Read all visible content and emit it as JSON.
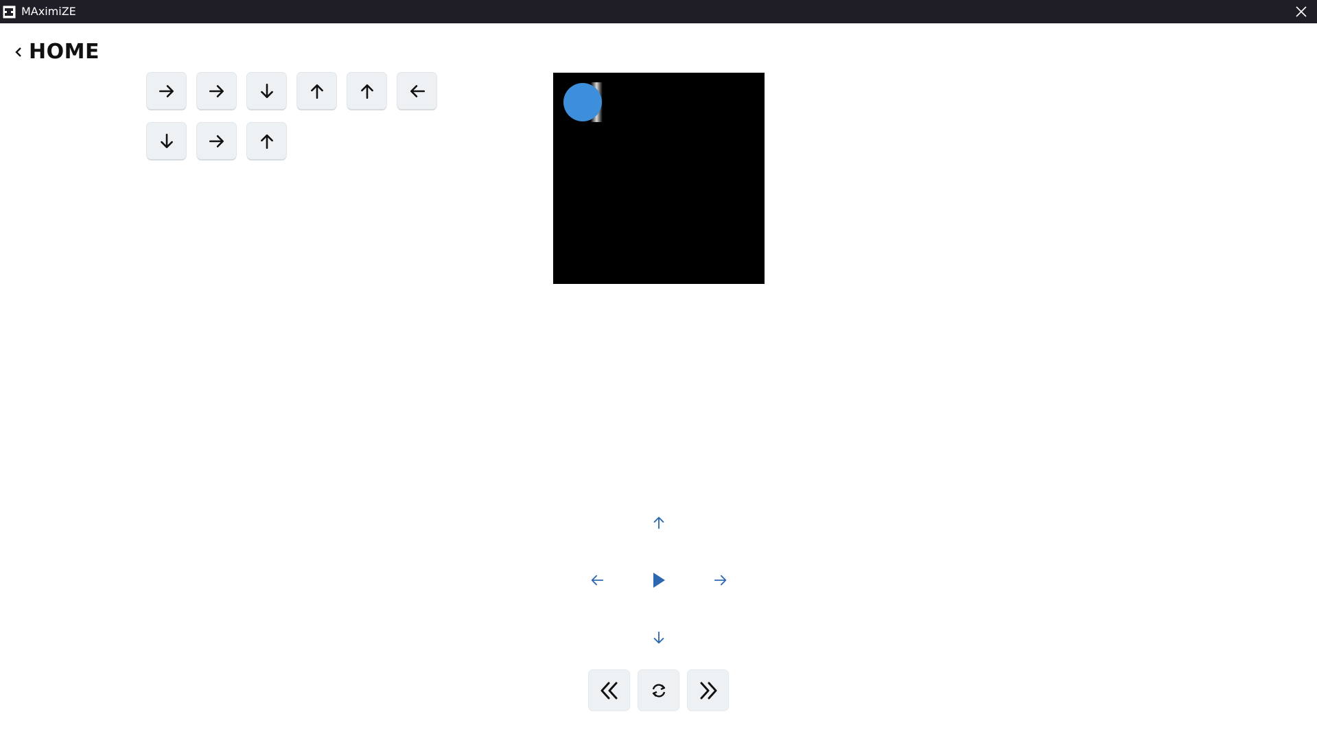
{
  "window": {
    "title": "MAximiZE",
    "app_icon": "app-logo-icon",
    "close_icon": "close-icon"
  },
  "nav": {
    "back_label": "HOME",
    "back_icon": "chevron-left-icon"
  },
  "command_queue": {
    "rows": [
      [
        "right",
        "right",
        "down",
        "up",
        "up",
        "left"
      ],
      [
        "down",
        "right",
        "up"
      ]
    ]
  },
  "board": {
    "background": "#000000",
    "ball_color": "#3d8fdb"
  },
  "controls": {
    "dpad": [
      "up",
      "left",
      "play",
      "right",
      "down"
    ],
    "accent": "#2d67b0",
    "playback": [
      "rewind-icon",
      "reset-icon",
      "fast-forward-icon"
    ]
  }
}
